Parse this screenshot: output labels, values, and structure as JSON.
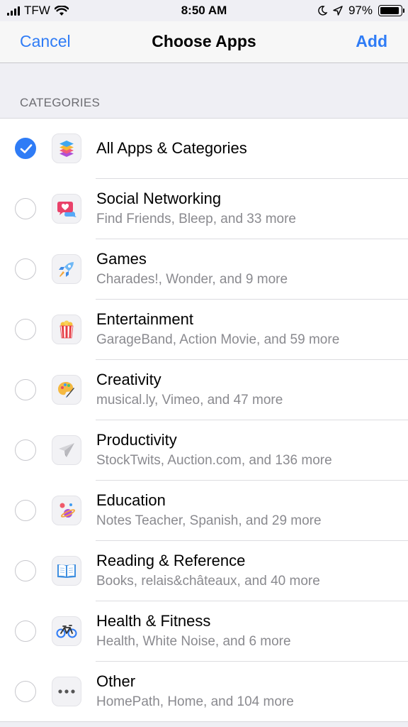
{
  "status_bar": {
    "carrier": "TFW",
    "time": "8:50 AM",
    "battery": "97%",
    "battery_level": 0.97
  },
  "nav": {
    "cancel": "Cancel",
    "title": "Choose Apps",
    "add": "Add"
  },
  "section_header": "CATEGORIES",
  "colors": {
    "accent": "#2f7cf6"
  },
  "categories": [
    {
      "title": "All Apps & Categories",
      "subtitle": "",
      "icon": "stack-layers-icon",
      "selected": true
    },
    {
      "title": "Social Networking",
      "subtitle": "Find Friends, Bleep, and 33 more",
      "icon": "heart-chat-bubble-icon",
      "selected": false
    },
    {
      "title": "Games",
      "subtitle": "Charades!, Wonder, and 9 more",
      "icon": "rocket-icon",
      "selected": false
    },
    {
      "title": "Entertainment",
      "subtitle": "GarageBand, Action Movie, and 59 more",
      "icon": "popcorn-icon",
      "selected": false
    },
    {
      "title": "Creativity",
      "subtitle": "musical.ly, Vimeo, and 47 more",
      "icon": "paint-palette-icon",
      "selected": false
    },
    {
      "title": "Productivity",
      "subtitle": "StockTwits, Auction.com, and 136 more",
      "icon": "paper-plane-icon",
      "selected": false
    },
    {
      "title": "Education",
      "subtitle": "Notes Teacher, Spanish, and 29 more",
      "icon": "planets-icon",
      "selected": false
    },
    {
      "title": "Reading & Reference",
      "subtitle": "Books, relais&châteaux, and 40 more",
      "icon": "open-book-icon",
      "selected": false
    },
    {
      "title": "Health & Fitness",
      "subtitle": "Health, White Noise, and 6 more",
      "icon": "bicycle-icon",
      "selected": false
    },
    {
      "title": "Other",
      "subtitle": "HomePath, Home, and 104 more",
      "icon": "more-dots-icon",
      "selected": false
    }
  ]
}
